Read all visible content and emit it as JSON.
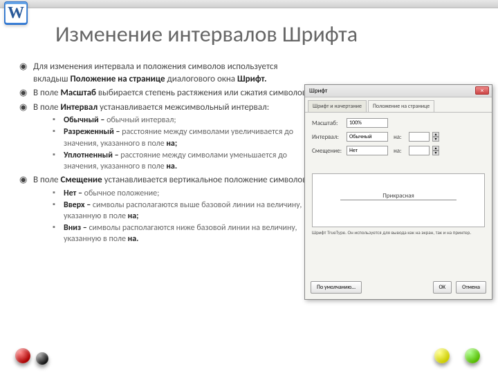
{
  "title": "Изменение интервалов Шрифта",
  "word_letter": "W",
  "bullets": {
    "b1a": "Для изменения интервала и положения символов используется вкладыш ",
    "b1b": "Положение на странице",
    "b1c": " диалогового окна ",
    "b1d": "Шрифт.",
    "b2a": "В поле ",
    "b2b": "Масштаб",
    "b2c": " выбирается степень растяжения или сжатия символов.",
    "b3a": "В поле ",
    "b3b": "Интервал",
    "b3c": " устанавливается межсимвольный интервал:",
    "b4a": "В поле ",
    "b4b": "Смещение",
    "b4c": " устанавливается вертикальное положение символов:"
  },
  "sub1": {
    "s1a": "Обычный –",
    "s1b": " обычный интервал;",
    "s2a": "Разреженный –",
    "s2b": " расстояние между символами увеличивается до значения, указанного в поле ",
    "s2c": "на;",
    "s3a": "Уплотненный –",
    "s3b": " расстояние между символами уменьшается до значения, указанного в поле ",
    "s3c": "на."
  },
  "sub2": {
    "s1a": "Нет –",
    "s1b": " обычное положение;",
    "s2a": "Вверх –",
    "s2b": " символы располагаются выше базовой линии на величину, указанную в поле ",
    "s2c": "на;",
    "s3a": "Вниз –",
    "s3b": " символы располагаются ниже базовой линии на величину, указанную в поле ",
    "s3c": "на."
  },
  "dialog": {
    "title": "Шрифт",
    "tab1": "Шрифт и начертание",
    "tab2": "Положение на странице",
    "row_scale": "Масштаб:",
    "row_interval": "Интервал:",
    "row_shift": "Смещение:",
    "val_scale": "100%",
    "val_interval": "Обычный",
    "val_shift": "Нет",
    "na_label": "на:",
    "preview_text": "Прикрасная",
    "truetype": "Шрифт TrueType. Он используется для вывода как на экран, так и на принтер.",
    "btn_default": "По умолчанию...",
    "btn_ok": "ОК",
    "btn_cancel": "Отмена",
    "close": "×"
  }
}
